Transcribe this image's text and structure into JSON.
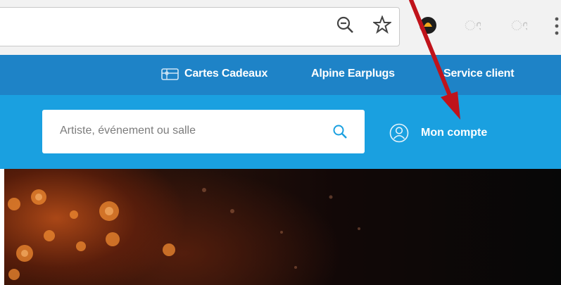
{
  "header": {
    "gift_cards_label": "Cartes Cadeaux",
    "earplugs_label": "Alpine Earplugs",
    "customer_service_label": "Service client"
  },
  "search": {
    "placeholder": "Artiste, événement ou salle"
  },
  "account": {
    "label": "Mon compte"
  },
  "colors": {
    "top_strip": "#1e83c7",
    "search_strip": "#1aa0e0",
    "annotation_arrow": "#c0131b"
  },
  "icons": {
    "browser": [
      "zoom-out-icon",
      "bookmark-star-icon",
      "extension-icon",
      "extension-icon",
      "extension-icon",
      "menu-icon"
    ],
    "header": [
      "gift-card-icon"
    ],
    "search": [
      "search-icon"
    ],
    "account": [
      "user-icon"
    ]
  }
}
